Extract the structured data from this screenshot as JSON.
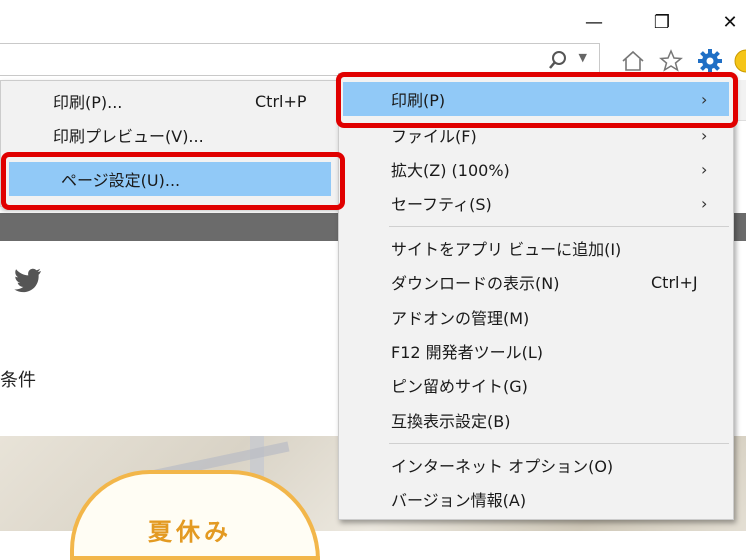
{
  "window": {
    "minimize_glyph": "—",
    "restore_glyph": "❐",
    "close_glyph": "✕"
  },
  "toolbar_icons": [
    "home-icon",
    "favorites-star-icon",
    "tools-gear-icon",
    "smiley-feedback-icon"
  ],
  "page": {
    "conditions_text": "条件",
    "banner_text": "夏休み"
  },
  "print_submenu": {
    "items": [
      {
        "label": "印刷(P)...",
        "shortcut": "Ctrl+P"
      },
      {
        "label": "印刷プレビュー(V)...",
        "shortcut": ""
      },
      {
        "label": "ページ設定(U)...",
        "shortcut": ""
      }
    ]
  },
  "tools_menu": {
    "items": [
      {
        "label": "印刷(P)",
        "shortcut": "",
        "arrow": "›"
      },
      {
        "label": "ファイル(F)",
        "shortcut": "",
        "arrow": "›"
      },
      {
        "label": "拡大(Z) (100%)",
        "shortcut": "",
        "arrow": "›"
      },
      {
        "label": "セーフティ(S)",
        "shortcut": "",
        "arrow": "›"
      },
      {
        "label": "サイトをアプリ ビューに追加(I)",
        "shortcut": ""
      },
      {
        "label": "ダウンロードの表示(N)",
        "shortcut": "Ctrl+J"
      },
      {
        "label": "アドオンの管理(M)",
        "shortcut": ""
      },
      {
        "label": "F12 開発者ツール(L)",
        "shortcut": ""
      },
      {
        "label": "ピン留めサイト(G)",
        "shortcut": ""
      },
      {
        "label": "互換表示設定(B)",
        "shortcut": ""
      },
      {
        "label": "インターネット オプション(O)",
        "shortcut": ""
      },
      {
        "label": "バージョン情報(A)",
        "shortcut": ""
      }
    ]
  },
  "colors": {
    "highlight": "#91c9f7",
    "annotation_red": "#e00000",
    "gear_blue": "#1f6fc5"
  }
}
